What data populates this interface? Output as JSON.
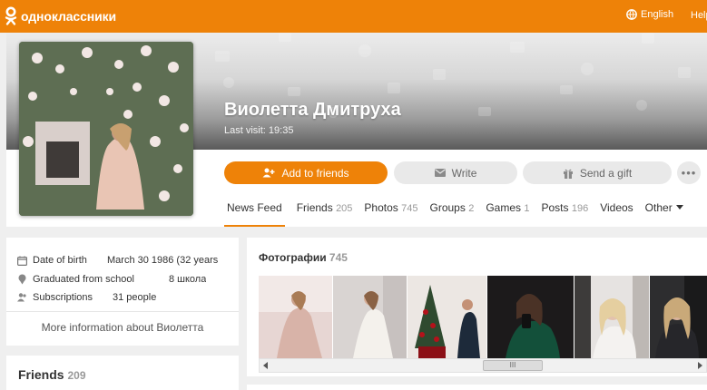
{
  "header": {
    "logo_text": "одноклассники",
    "language": "English",
    "help": "Help"
  },
  "profile": {
    "name": "Виолетта Дмитруха",
    "last_visit": "Last visit: 19:35",
    "actions": {
      "add_friend": "Add to friends",
      "write": "Write",
      "gift": "Send a gift",
      "more": "•••"
    },
    "tabs": [
      {
        "label": "News Feed",
        "count": ""
      },
      {
        "label": "Friends",
        "count": "205"
      },
      {
        "label": "Photos",
        "count": "745"
      },
      {
        "label": "Groups",
        "count": "2"
      },
      {
        "label": "Games",
        "count": "1"
      },
      {
        "label": "Posts",
        "count": "196"
      },
      {
        "label": "Videos",
        "count": ""
      },
      {
        "label": "Other",
        "count": ""
      }
    ]
  },
  "info": {
    "rows": [
      {
        "label": "Date of birth",
        "value": "March 30 1986 (32 years",
        "icon": "calendar-icon"
      },
      {
        "label": "Graduated from school",
        "value": "8 школа",
        "icon": "pin-icon"
      },
      {
        "label": "Subscriptions",
        "value": "31 people",
        "icon": "people-icon"
      }
    ],
    "more_link": "More information about Виолетта"
  },
  "friends": {
    "title": "Friends",
    "count": "209"
  },
  "photos": {
    "title": "Фотографии",
    "count": "745",
    "scroll_thumb": "III"
  },
  "colors": {
    "brand": "#ee8208",
    "page_bg": "#efefef"
  }
}
